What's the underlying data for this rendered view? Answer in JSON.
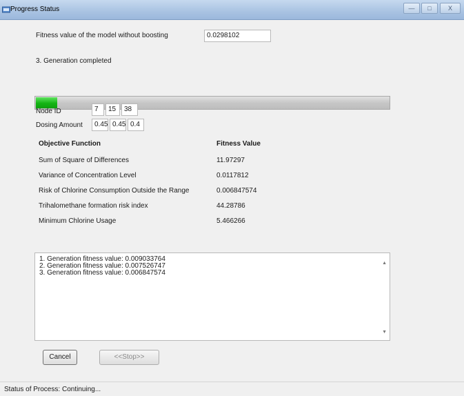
{
  "window": {
    "title": "Progress Status",
    "buttons": {
      "minimize": "—",
      "maximize": "□",
      "close": "X"
    }
  },
  "model_fitness": {
    "label": "Fitness value of the model without boosting",
    "value": "0.0298102"
  },
  "generation_status": "3. Generation completed",
  "progress": {
    "fraction": 0.06,
    "color": "#13b413"
  },
  "node_id": {
    "label": "Node ID",
    "values": [
      "7",
      "15",
      "38"
    ]
  },
  "dosing_amount": {
    "label": "Dosing Amount",
    "values": [
      "0.45",
      "0.45",
      "0.4"
    ]
  },
  "objectives": {
    "header_function": "Objective Function",
    "header_value": "Fitness Value",
    "rows": [
      {
        "name": "Sum of Square of Differences",
        "value": "11.97297"
      },
      {
        "name": "Variance of Concentration Level",
        "value": "0.0117812"
      },
      {
        "name": "Risk of Chlorine Consumption Outside the Range",
        "value": "0.006847574"
      },
      {
        "name": "Trihalomethane formation risk index",
        "value": "44.28786"
      },
      {
        "name": "Minimum Chlorine Usage",
        "value": "5.466266"
      }
    ]
  },
  "log": {
    "lines": [
      "1. Generation fitness value: 0.009033764",
      "2. Generation fitness value: 0.007526747",
      "3. Generation fitness value: 0.006847574"
    ]
  },
  "buttons": {
    "cancel": "Cancel",
    "stop": "<<Stop>>"
  },
  "status": {
    "label": "Status of Process:",
    "value": "Continuing..."
  }
}
